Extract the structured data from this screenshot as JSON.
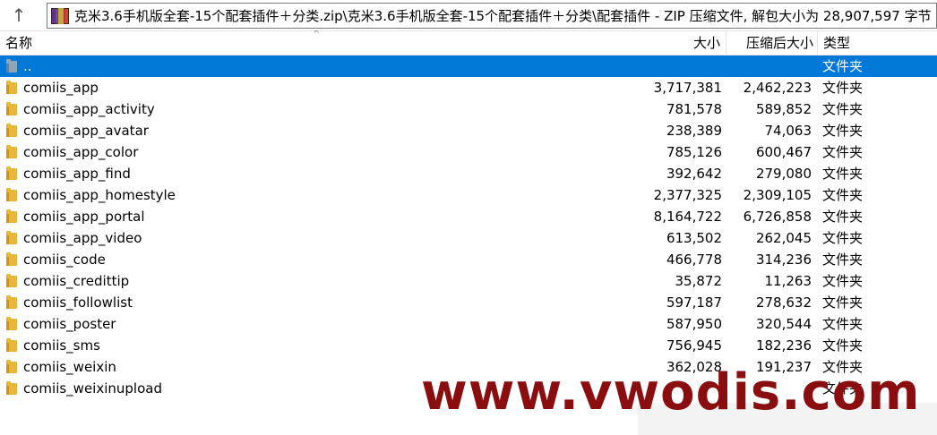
{
  "address_bar": {
    "path": "克米3.6手机版全套-15个配套插件＋分类.zip\\克米3.6手机版全套-15个配套插件＋分类\\配套插件 - ZIP 压缩文件, 解包大小为 28,907,597 字节"
  },
  "columns": {
    "name": "名称",
    "size": "大小",
    "packed": "压缩后大小",
    "type": "类型"
  },
  "rows": [
    {
      "name": "..",
      "size": "",
      "packed": "",
      "type": "文件夹"
    },
    {
      "name": "comiis_app",
      "size": "3,717,381",
      "packed": "2,462,223",
      "type": "文件夹"
    },
    {
      "name": "comiis_app_activity",
      "size": "781,578",
      "packed": "589,852",
      "type": "文件夹"
    },
    {
      "name": "comiis_app_avatar",
      "size": "238,389",
      "packed": "74,063",
      "type": "文件夹"
    },
    {
      "name": "comiis_app_color",
      "size": "785,126",
      "packed": "600,467",
      "type": "文件夹"
    },
    {
      "name": "comiis_app_find",
      "size": "392,642",
      "packed": "279,080",
      "type": "文件夹"
    },
    {
      "name": "comiis_app_homestyle",
      "size": "2,377,325",
      "packed": "2,309,105",
      "type": "文件夹"
    },
    {
      "name": "comiis_app_portal",
      "size": "8,164,722",
      "packed": "6,726,858",
      "type": "文件夹"
    },
    {
      "name": "comiis_app_video",
      "size": "613,502",
      "packed": "262,045",
      "type": "文件夹"
    },
    {
      "name": "comiis_code",
      "size": "466,778",
      "packed": "314,236",
      "type": "文件夹"
    },
    {
      "name": "comiis_credittip",
      "size": "35,872",
      "packed": "11,263",
      "type": "文件夹"
    },
    {
      "name": "comiis_followlist",
      "size": "597,187",
      "packed": "278,632",
      "type": "文件夹"
    },
    {
      "name": "comiis_poster",
      "size": "587,950",
      "packed": "320,544",
      "type": "文件夹"
    },
    {
      "name": "comiis_sms",
      "size": "756,945",
      "packed": "182,236",
      "type": "文件夹"
    },
    {
      "name": "comiis_weixin",
      "size": "362,028",
      "packed": "191,237",
      "type": "文件夹"
    },
    {
      "name": "comiis_weixinupload",
      "size": "",
      "packed": "",
      "type": "文件夹"
    }
  ],
  "selected_row": 0,
  "watermark": "www.vwodis.com",
  "colors": {
    "selection": "#0078d7",
    "folder": "#e9b53a",
    "watermark": "#8a0e10"
  }
}
